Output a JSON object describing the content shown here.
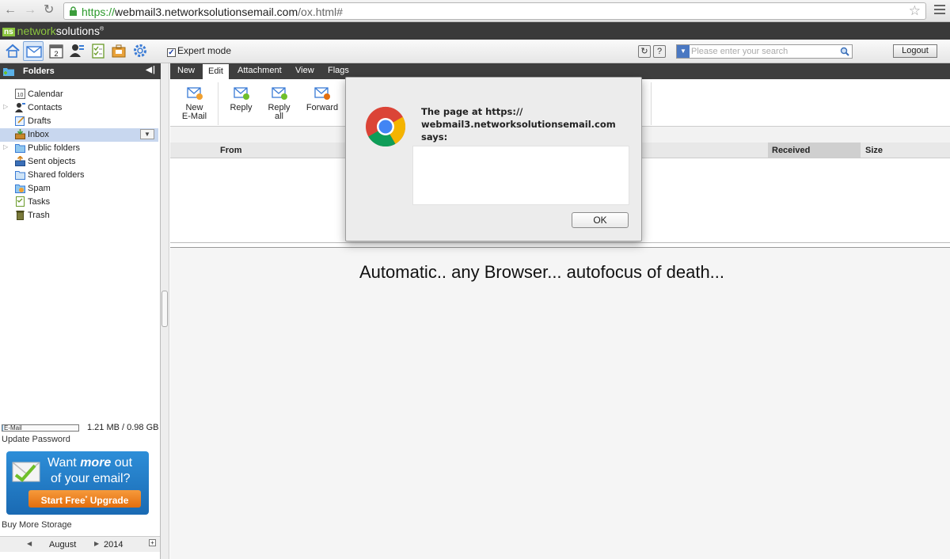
{
  "browser": {
    "url_scheme": "https://",
    "url_host": "webmail3.networksolutionsemail.com",
    "url_path": "/ox.html#"
  },
  "brand": {
    "logo_mark": "ns",
    "logo_text_a": "network",
    "logo_text_b": "solutions",
    "logo_sup": "®"
  },
  "toolbar": {
    "calendar_badge": "2",
    "expert_mode_label": "Expert mode",
    "help_label": "?",
    "search_placeholder": "Please enter your search",
    "logout_label": "Logout"
  },
  "folders": {
    "header": "Folders",
    "calendar_badge": "10",
    "items": [
      {
        "label": "Calendar"
      },
      {
        "label": "Contacts"
      },
      {
        "label": "Drafts"
      },
      {
        "label": "Inbox"
      },
      {
        "label": "Public folders"
      },
      {
        "label": "Sent objects"
      },
      {
        "label": "Shared folders"
      },
      {
        "label": "Spam"
      },
      {
        "label": "Tasks"
      },
      {
        "label": "Trash"
      }
    ],
    "selected": "Inbox"
  },
  "quota": {
    "label": "E-Mail",
    "usage": "1.21 MB / 0.98 GB",
    "fill_fraction": 0.0012
  },
  "sidebar_links": {
    "update_password": "Update Password",
    "buy_storage": "Buy More Storage"
  },
  "promo": {
    "line1_a": "Want ",
    "line1_b": "more",
    "line1_c": " out",
    "line2": "of your email?",
    "cta_a": "Start Free",
    "cta_sup": "*",
    "cta_b": " Upgrade"
  },
  "minical": {
    "month": "August",
    "year": "2014"
  },
  "tabs": [
    "New",
    "Edit",
    "Attachment",
    "View",
    "Flags"
  ],
  "active_tab": "Edit",
  "ribbon": {
    "new_email_1": "New",
    "new_email_2": "E-Mail",
    "reply": "Reply",
    "reply_all_1": "Reply",
    "reply_all_2": "all",
    "forward": "Forward"
  },
  "list": {
    "columns": {
      "from": "From",
      "received": "Received",
      "size": "Size"
    }
  },
  "preview": {
    "text": "Automatic.. any Browser... autofocus of death..."
  },
  "dialog": {
    "title_line1": "The page at https://",
    "title_line2": "webmail3.networksolutionsemail.com",
    "title_line3": "says:",
    "message": "",
    "ok_label": "OK"
  },
  "colors": {
    "header_dark": "#3a3a3a",
    "brand_green": "#8cc63f",
    "selection": "#c8d7ef",
    "promo_blue": "#2d8ed8",
    "promo_orange": "#e36e0e"
  }
}
